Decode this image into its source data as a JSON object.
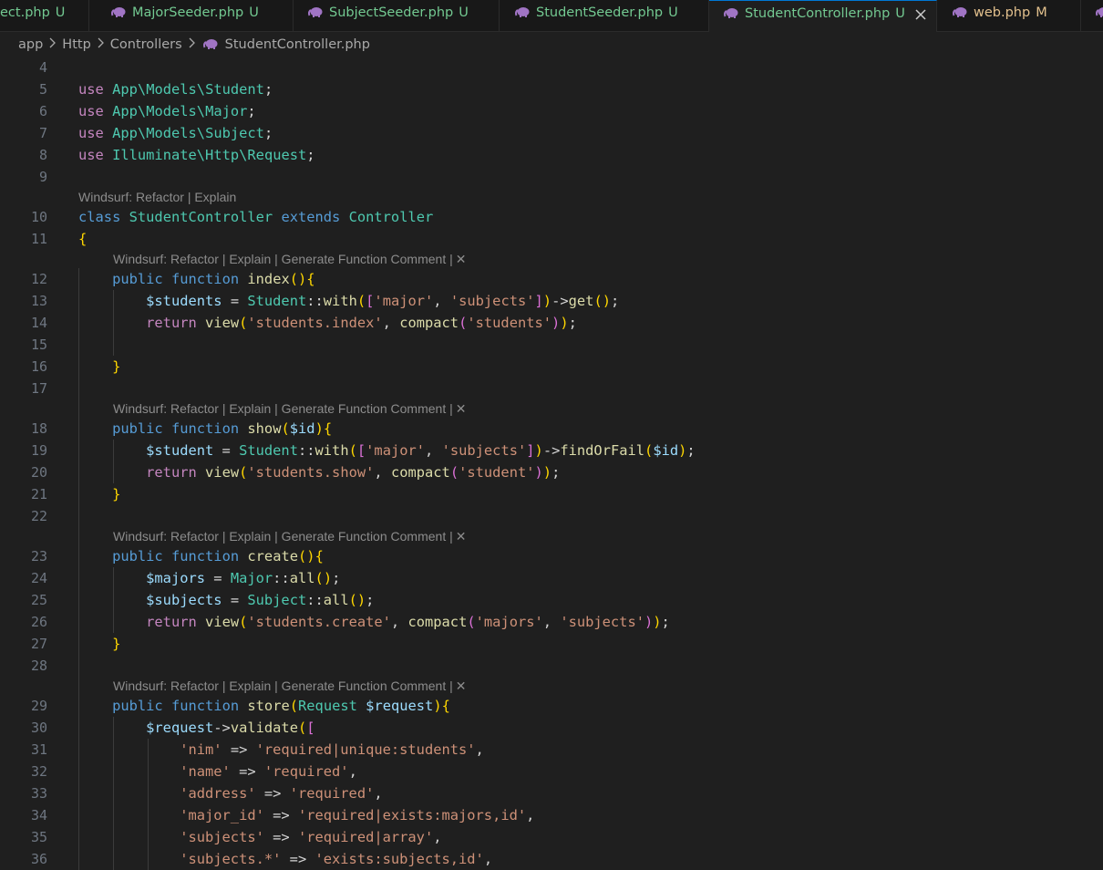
{
  "tabs": [
    {
      "name": "ect.php",
      "status": "U"
    },
    {
      "name": "MajorSeeder.php",
      "status": "U"
    },
    {
      "name": "SubjectSeeder.php",
      "status": "U"
    },
    {
      "name": "StudentSeeder.php",
      "status": "U"
    },
    {
      "name": "StudentController.php",
      "status": "U",
      "active": true
    },
    {
      "name": "web.php",
      "status": "M"
    }
  ],
  "breadcrumb": [
    "app",
    "Http",
    "Controllers",
    "StudentController.php"
  ],
  "codelens": {
    "class_label": "Windsurf: Refactor | Explain",
    "method_label": "Windsurf: Refactor | Explain | Generate Function Comment |",
    "close_glyph": "✕"
  },
  "editor": {
    "lines": [
      {
        "n": "4",
        "text": ""
      },
      {
        "n": "5",
        "text": "use App\\Models\\Student;"
      },
      {
        "n": "6",
        "text": "use App\\Models\\Major;"
      },
      {
        "n": "7",
        "text": "use App\\Models\\Subject;"
      },
      {
        "n": "8",
        "text": "use Illuminate\\Http\\Request;"
      },
      {
        "n": "9",
        "text": ""
      },
      {
        "n": "10",
        "text": "class StudentController extends Controller"
      },
      {
        "n": "11",
        "text": "{"
      },
      {
        "n": "12",
        "text": "    public function index(){"
      },
      {
        "n": "13",
        "text": "        $students = Student::with(['major', 'subjects'])->get();"
      },
      {
        "n": "14",
        "text": "        return view('students.index', compact('students'));"
      },
      {
        "n": "15",
        "text": ""
      },
      {
        "n": "16",
        "text": "    }"
      },
      {
        "n": "17",
        "text": ""
      },
      {
        "n": "18",
        "text": "    public function show($id){"
      },
      {
        "n": "19",
        "text": "        $student = Student::with(['major', 'subjects'])->findOrFail($id);"
      },
      {
        "n": "20",
        "text": "        return view('students.show', compact('student'));"
      },
      {
        "n": "21",
        "text": "    }"
      },
      {
        "n": "22",
        "text": ""
      },
      {
        "n": "23",
        "text": "    public function create(){"
      },
      {
        "n": "24",
        "text": "        $majors = Major::all();"
      },
      {
        "n": "25",
        "text": "        $subjects = Subject::all();"
      },
      {
        "n": "26",
        "text": "        return view('students.create', compact('majors', 'subjects'));"
      },
      {
        "n": "27",
        "text": "    }"
      },
      {
        "n": "28",
        "text": ""
      },
      {
        "n": "29",
        "text": "    public function store(Request $request){"
      },
      {
        "n": "30",
        "text": "        $request->validate(["
      },
      {
        "n": "31",
        "text": "            'nim' => 'required|unique:students',"
      },
      {
        "n": "32",
        "text": "            'name' => 'required',"
      },
      {
        "n": "33",
        "text": "            'address' => 'required',"
      },
      {
        "n": "34",
        "text": "            'major_id' => 'required|exists:majors,id',"
      },
      {
        "n": "35",
        "text": "            'subjects' => 'required|array',"
      },
      {
        "n": "36",
        "text": "            'subjects.*' => 'exists:subjects,id',"
      }
    ]
  },
  "colors": {
    "background": "#1f1f1f",
    "keyword": "#569cd6",
    "control": "#c586c0",
    "class": "#4ec9b0",
    "function": "#dcdcaa",
    "variable": "#9cdcfe",
    "string": "#ce9178",
    "untracked": "#73c991",
    "modified": "#e2c08d"
  }
}
